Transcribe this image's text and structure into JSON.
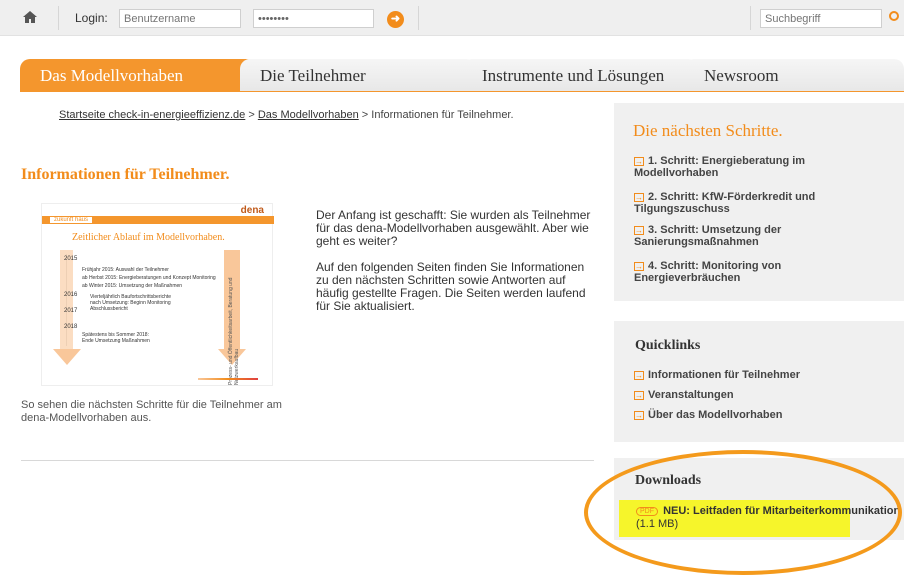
{
  "header": {
    "login_label": "Login:",
    "username_placeholder": "Benutzername",
    "password_value": "••••••••",
    "search_placeholder": "Suchbegriff"
  },
  "tabs": [
    {
      "label": "Das Modellvorhaben",
      "active": true
    },
    {
      "label": "Die Teilnehmer"
    },
    {
      "label": "Instrumente und Lösungen"
    },
    {
      "label": "Newsroom"
    }
  ],
  "breadcrumb": {
    "home": "Startseite check-in-energieeffizienz.de",
    "sep1": " > ",
    "parent": "Das Modellvorhaben",
    "sep2": " > ",
    "current": "Informationen für Teilnehmer."
  },
  "main": {
    "title": "Informationen für Teilnehmer.",
    "intro_p1": "Der Anfang ist geschafft: Sie wurden als Teilnehmer für das dena-Modellvorhaben ausgewählt. Aber wie geht es weiter?",
    "intro_p2": "Auf den folgenden Seiten finden Sie Informationen zu den nächsten Schritten sowie Antworten auf häufig gestellte Fragen. Die Seiten werden laufend für Sie aktualisiert.",
    "caption": "So sehen die nächsten Schritte für die Teilnehmer am dena-Modellvorhaben aus."
  },
  "thumbnail": {
    "logo": "dena",
    "badge": "zukunft haus",
    "title": "Zeitlicher Ablauf im Modellvorhaben.",
    "years": [
      "2015",
      "2016",
      "2017",
      "2018"
    ],
    "lines": [
      "Frühjahr 2015: Auswahl der Teilnehmer",
      "ab Herbst 2015: Energieberatungen und Konzept Monitoring",
      "ab Winter 2015: Umsetzung der Maßnahmen",
      "Vierteljährlich Baufortschrittsberichte",
      "nach Umsetzung: Beginn Monitoring",
      "Abschlussbericht",
      "Spätestens bis Sommer 2018:",
      "Ende Umsetzung Maßnahmen"
    ],
    "side_text": "Prozess- und Öffentlichkeitsarbeit, Beratung und Netzwerkaufbau"
  },
  "sidebar": {
    "steps_title": "Die nächsten Schritte.",
    "steps": [
      "1. Schritt: Energieberatung im Modellvorhaben",
      "2. Schritt: KfW-Förderkredit und Tilgungszuschuss",
      "3. Schritt: Umsetzung der Sanierungsmaßnahmen",
      "4. Schritt: Monitoring von Energieverbräuchen"
    ],
    "quicklinks_title": "Quicklinks",
    "quicklinks": [
      "Informationen für Teilnehmer",
      "Veranstaltungen",
      "Über das Modellvorhaben"
    ],
    "downloads_title": "Downloads",
    "download": {
      "badge": "PDF",
      "label": "NEU: Leitfaden für Mitarbeiterkommunikation",
      "size": "(1.1 MB)"
    }
  },
  "colors": {
    "accent": "#f28c1b",
    "highlight": "#f6f52b"
  }
}
